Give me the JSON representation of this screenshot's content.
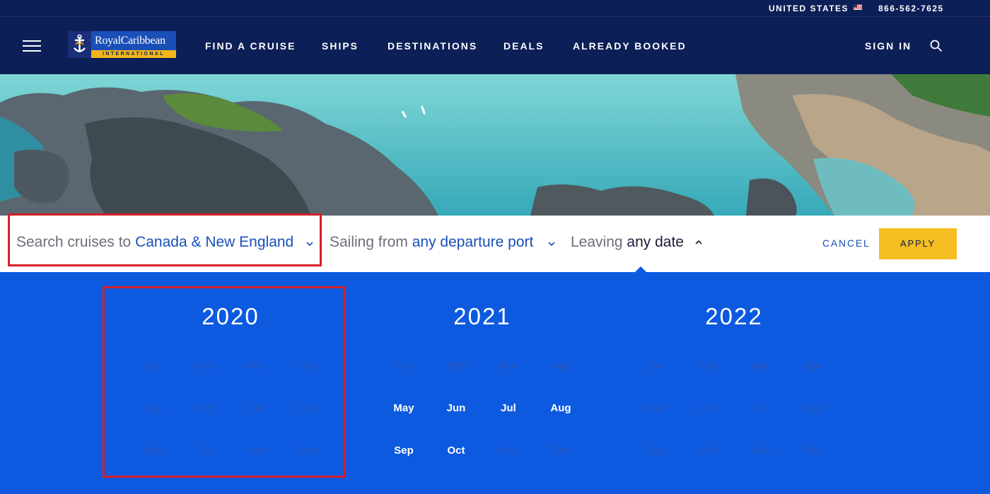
{
  "utility": {
    "country": "UNITED STATES",
    "flag_icon": "us-flag-icon",
    "phone": "866-562-7625"
  },
  "nav": {
    "logo_top": "RoyalCaribbean",
    "logo_bottom": "INTERNATIONAL",
    "links": [
      "FIND A CRUISE",
      "SHIPS",
      "DESTINATIONS",
      "DEALS",
      "ALREADY BOOKED"
    ],
    "sign_in": "SIGN IN",
    "icons": [
      "hamburger-menu-icon",
      "search-icon"
    ]
  },
  "search": {
    "dest_prefix": "Search cruises to ",
    "dest_value": "Canada & New England",
    "port_prefix": "Sailing from ",
    "port_value": "any departure port",
    "date_prefix": "Leaving ",
    "date_value": "any date",
    "cancel": "CANCEL",
    "apply": "APPLY"
  },
  "calendar": {
    "years": [
      {
        "year": "2020",
        "months": [
          {
            "m": "Jan",
            "on": false
          },
          {
            "m": "Feb",
            "on": false
          },
          {
            "m": "Mar",
            "on": false
          },
          {
            "m": "Apr",
            "on": false
          },
          {
            "m": "May",
            "on": false
          },
          {
            "m": "Jun",
            "on": false
          },
          {
            "m": "Jul",
            "on": false
          },
          {
            "m": "Aug",
            "on": false
          },
          {
            "m": "Sep",
            "on": false
          },
          {
            "m": "Oct",
            "on": false
          },
          {
            "m": "Nov",
            "on": false
          },
          {
            "m": "Dec",
            "on": false
          }
        ]
      },
      {
        "year": "2021",
        "months": [
          {
            "m": "Jan",
            "on": false
          },
          {
            "m": "Feb",
            "on": false
          },
          {
            "m": "Mar",
            "on": false
          },
          {
            "m": "Apr",
            "on": false
          },
          {
            "m": "May",
            "on": true
          },
          {
            "m": "Jun",
            "on": true
          },
          {
            "m": "Jul",
            "on": true
          },
          {
            "m": "Aug",
            "on": true
          },
          {
            "m": "Sep",
            "on": true
          },
          {
            "m": "Oct",
            "on": true
          },
          {
            "m": "Nov",
            "on": false
          },
          {
            "m": "Dec",
            "on": false
          }
        ]
      },
      {
        "year": "2022",
        "months": [
          {
            "m": "Jan",
            "on": false
          },
          {
            "m": "Feb",
            "on": false
          },
          {
            "m": "Mar",
            "on": false
          },
          {
            "m": "Apr",
            "on": false
          },
          {
            "m": "May",
            "on": false
          },
          {
            "m": "Jun",
            "on": false
          },
          {
            "m": "Jul",
            "on": false
          },
          {
            "m": "Aug",
            "on": false
          },
          {
            "m": "Sep",
            "on": false
          },
          {
            "m": "Oct",
            "on": false
          },
          {
            "m": "Nov",
            "on": false
          },
          {
            "m": "Dec",
            "on": false
          }
        ]
      }
    ]
  },
  "colors": {
    "navy": "#0c1f57",
    "brand_blue": "#1a4fb8",
    "panel_blue": "#0d5ae0",
    "apply_yellow": "#f5bd1f",
    "highlight_red": "#d61f26"
  }
}
